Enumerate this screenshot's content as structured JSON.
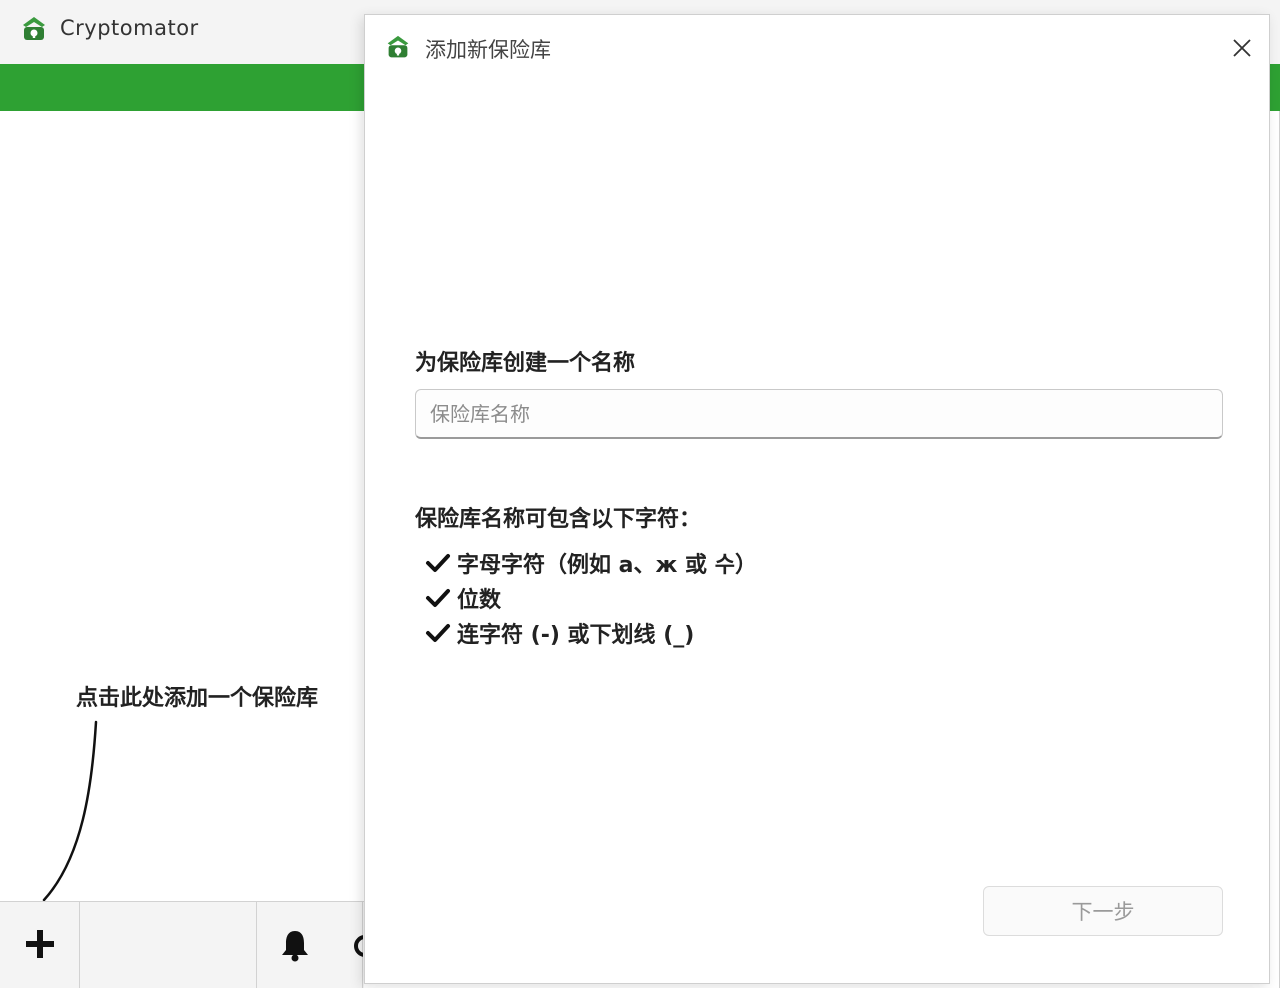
{
  "main_window": {
    "app_title": "Cryptomator",
    "accent_color": "#2ea133",
    "annotation": "点击此处添加一个保险库",
    "bottom_bar": {
      "add_icon": "plus-icon",
      "bell_icon": "bell-icon"
    }
  },
  "dialog": {
    "title": "添加新保险库",
    "close_icon": "close-icon",
    "name_heading": "为保险库创建一个名称",
    "name_placeholder": "保险库名称",
    "name_value": "",
    "rules_heading": "保险库名称可包含以下字符：",
    "rules": [
      "字母字符（例如 a、ж 或 수）",
      "位数",
      "连字符 (-) 或下划线 (_)"
    ],
    "next_label": "下一步"
  }
}
